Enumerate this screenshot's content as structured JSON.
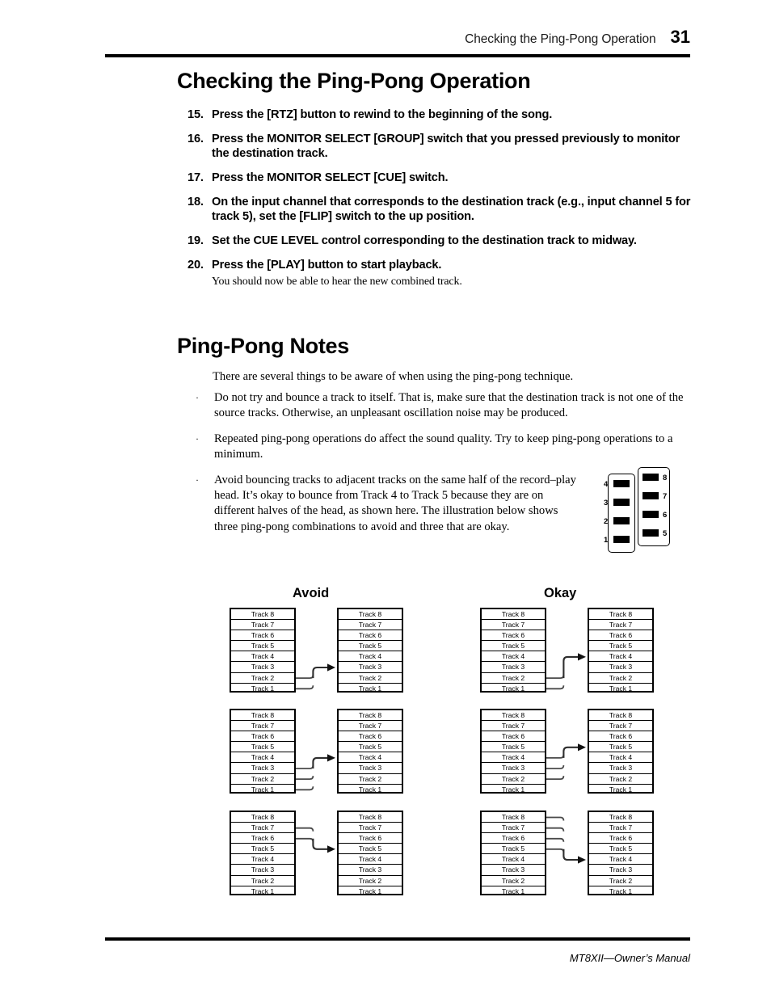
{
  "header": {
    "title": "Checking the Ping-Pong Operation",
    "page_number": "31"
  },
  "headings": {
    "main": "Checking the Ping-Pong Operation",
    "notes": "Ping-Pong Notes"
  },
  "steps": [
    {
      "num": "15.",
      "text": "Press the [RTZ] button to rewind to the beginning of the song."
    },
    {
      "num": "16.",
      "text": "Press the MONITOR SELECT [GROUP] switch that you pressed previously to monitor the destination track."
    },
    {
      "num": "17.",
      "text": "Press the MONITOR SELECT [CUE] switch."
    },
    {
      "num": "18.",
      "text": "On the input channel that corresponds to the destination track (e.g., input channel 5 for track 5), set the [FLIP] switch to the up position."
    },
    {
      "num": "19.",
      "text": "Set the CUE LEVEL control corresponding to the destination track to midway."
    },
    {
      "num": "20.",
      "text": "Press the [PLAY] button to start playback.",
      "sub": "You should now be able to hear the new combined track."
    }
  ],
  "notes": {
    "intro": "There are several things to be aware of when using the ping-pong technique.",
    "bullet_marker": "·",
    "bullets": [
      "Do not try and bounce a track to itself. That is, make sure that the destination track is not one of the source tracks. Otherwise, an unpleasant oscillation noise may be produced.",
      "Repeated ping-pong operations do affect the sound quality. Try to keep ping-pong operations to a minimum.",
      "Avoid bouncing tracks to adjacent tracks on the same half of the record–play head. It’s okay to bounce from Track 4 to Track 5 because they are on different halves of the head, as shown here. The illustration below shows three ping-pong combinations to avoid and three that are okay."
    ]
  },
  "head_diagram": {
    "left_labels": [
      "4",
      "3",
      "2",
      "1"
    ],
    "right_labels": [
      "8",
      "7",
      "6",
      "5"
    ]
  },
  "diagrams": {
    "avoid_title": "Avoid",
    "okay_title": "Okay",
    "track_labels": [
      "Track 8",
      "Track 7",
      "Track 6",
      "Track 5",
      "Track 4",
      "Track 3",
      "Track 2",
      "Track 1"
    ],
    "rows": [
      {
        "avoid": {
          "sources": [
            1,
            2
          ],
          "destination": 3
        },
        "okay": {
          "sources": [
            1,
            2
          ],
          "destination": 4
        }
      },
      {
        "avoid": {
          "sources": [
            1,
            2,
            3
          ],
          "destination": 4
        },
        "okay": {
          "sources": [
            2,
            3,
            4
          ],
          "destination": 5
        }
      },
      {
        "avoid": {
          "sources": [
            6,
            7
          ],
          "destination": 5
        },
        "okay": {
          "sources": [
            5,
            6,
            7,
            8
          ],
          "destination": 4
        }
      }
    ]
  },
  "footer": {
    "text": "MT8XII—Owner’s Manual"
  }
}
